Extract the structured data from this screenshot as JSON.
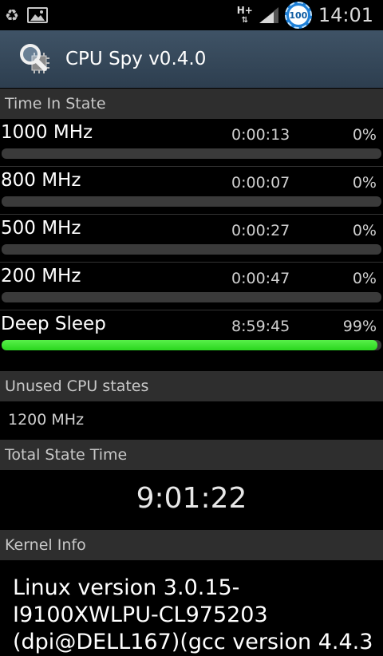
{
  "status_bar": {
    "left_icons": [
      "recycle-icon",
      "picture-icon"
    ],
    "network_type": "H+",
    "battery_level": "100",
    "clock": "14:01"
  },
  "title_bar": {
    "app_icon": "cpu-magnifier-icon",
    "title": "CPU Spy v0.4.0"
  },
  "time_in_state": {
    "header": "Time In State",
    "states": [
      {
        "name": "1000 MHz",
        "time": "0:00:13",
        "percent": "0%",
        "fill_fraction": 0.0
      },
      {
        "name": "800 MHz",
        "time": "0:00:07",
        "percent": "0%",
        "fill_fraction": 0.0
      },
      {
        "name": "500 MHz",
        "time": "0:00:27",
        "percent": "0%",
        "fill_fraction": 0.0
      },
      {
        "name": "200 MHz",
        "time": "0:00:47",
        "percent": "0%",
        "fill_fraction": 0.0
      },
      {
        "name": "Deep Sleep",
        "time": "8:59:45",
        "percent": "99%",
        "fill_fraction": 0.99
      }
    ],
    "bar_color": "#2ad61e"
  },
  "unused_states": {
    "header": "Unused CPU states",
    "value": "1200 MHz"
  },
  "total_state_time": {
    "header": "Total State Time",
    "value": "9:01:22"
  },
  "kernel_info": {
    "header": "Kernel Info",
    "text": "Linux version 3.0.15-\nI9100XWLPU-CL975203\n(dpi@DELL167)(gcc version 4.4.3"
  }
}
